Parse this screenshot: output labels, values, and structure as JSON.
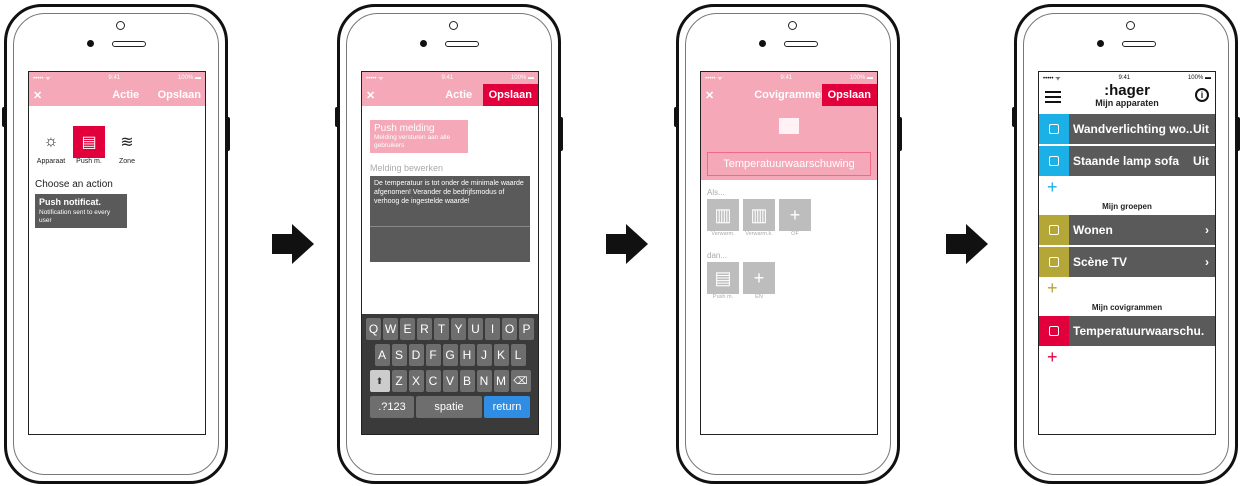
{
  "colors": {
    "accent": "#e2003c",
    "blue": "#1bb0e6",
    "olive": "#b5a638",
    "pink": "#f4a8b8",
    "gray": "#5a5a5a"
  },
  "screen1": {
    "status": {
      "signal": "••••• ᯤ",
      "time": "9:41",
      "battery": "100% ▬"
    },
    "nav": {
      "close": "✕",
      "title": "Actie",
      "save": "Opslaan"
    },
    "actions": [
      {
        "label": "Apparaat",
        "icon": "bulb-icon"
      },
      {
        "label": "Push m.",
        "icon": "message-icon"
      },
      {
        "label": "Zone",
        "icon": "heat-icon"
      }
    ],
    "choose_label": "Choose an action",
    "card": {
      "title": "Push notificat.",
      "sub": "Notification sent to every user"
    }
  },
  "screen2": {
    "status": {
      "signal": "••••• ᯤ",
      "time": "9:41",
      "battery": "100% ▬"
    },
    "nav": {
      "close": "✕",
      "title": "Actie",
      "save": "Opslaan"
    },
    "push": {
      "title": "Push melding",
      "sub": "Melding versturen aan alle gebruikers"
    },
    "edit_label": "Melding bewerken",
    "message": "De temperatuur is tot onder de minimale waarde afgenomen! Verander de bedrijfsmodus of verhoog de ingestelde waarde!",
    "keyboard": {
      "row1": [
        "Q",
        "W",
        "E",
        "R",
        "T",
        "Y",
        "U",
        "I",
        "O",
        "P"
      ],
      "row2": [
        "A",
        "S",
        "D",
        "F",
        "G",
        "H",
        "J",
        "K",
        "L"
      ],
      "row3": [
        "Z",
        "X",
        "C",
        "V",
        "B",
        "N",
        "M"
      ],
      "num": ".?123",
      "space": "spatie",
      "return": "return",
      "backspace": "⌫",
      "shift": "⬆"
    }
  },
  "screen3": {
    "status": {
      "signal": "••••• ᯤ",
      "time": "9:41",
      "battery": "100% ▬"
    },
    "nav": {
      "close": "✕",
      "title": "Covigrammen",
      "save": "Opslaan"
    },
    "name": "Temperatuurwaarschuwing",
    "if_label": "Als...",
    "if_tiles": [
      {
        "icon": "radiator-icon",
        "label": "Verwarm."
      },
      {
        "icon": "radiator-icon",
        "label": "Verwarm.k."
      },
      {
        "icon": "plus-icon",
        "label": "OF"
      }
    ],
    "then_label": "dan...",
    "then_tiles": [
      {
        "icon": "message-icon",
        "label": "Push m."
      },
      {
        "icon": "plus-icon",
        "label": "EN"
      }
    ]
  },
  "screen4": {
    "status": {
      "signal": "••••• ᯤ",
      "time": "9:41",
      "battery": "100% ▬"
    },
    "brand": ":hager",
    "devices_title": "Mijn apparaten",
    "devices": [
      {
        "name": "Wandverlichting wo..",
        "state": "Uit"
      },
      {
        "name": "Staande lamp sofa",
        "state": "Uit"
      }
    ],
    "groups_title": "Mijn groepen",
    "groups": [
      {
        "name": "Wonen",
        "chevron": "›"
      },
      {
        "name": "Scène TV",
        "chevron": "›"
      }
    ],
    "covi_title": "Mijn covigrammen",
    "covis": [
      {
        "name": "Temperatuurwaarschu."
      }
    ],
    "plus": "+",
    "info": "i"
  }
}
